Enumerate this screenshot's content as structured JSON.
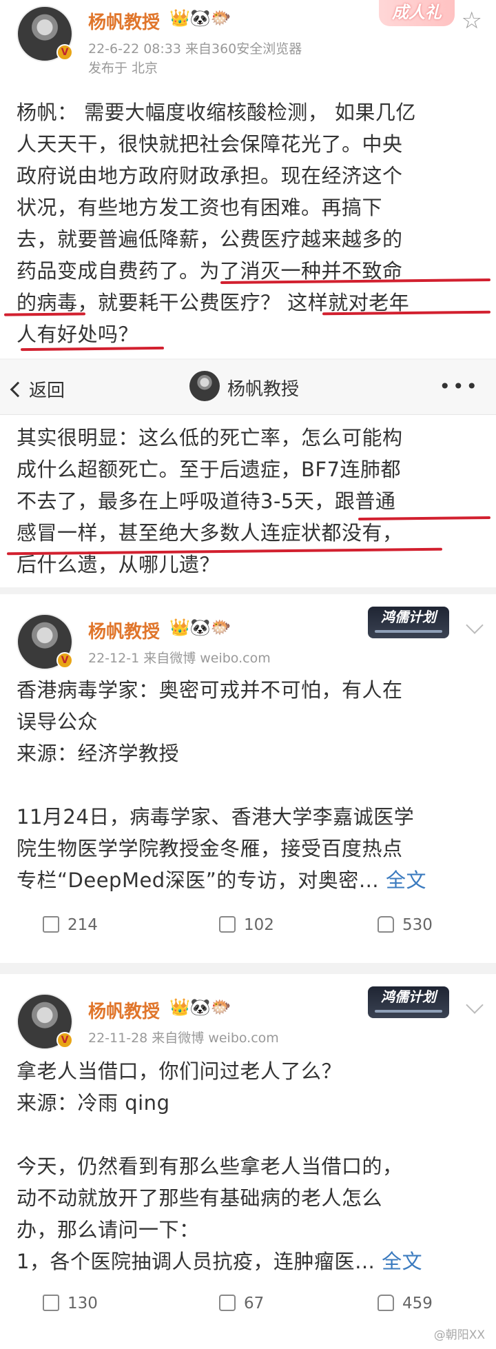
{
  "post1": {
    "user": "杨帆教授",
    "badges": "👑🐼🐡",
    "meta_line1": "22-6-22 08:33  来自360安全浏览器",
    "meta_line2": "发布于 北京",
    "ribbon": "成人礼",
    "lines": [
      "杨帆： 需要大幅度收缩核酸检测， 如果几亿",
      "人天天干，很快就把社会保障花光了。中央",
      "政府说由地方政府财政承担。现在经济这个",
      "状况，有些地方发工资也有困难。再搞下",
      "去，就要普遍低降薪，公费医疗越来越多的",
      "药品变成自费药了。为了消灭一种并不致命",
      "的病毒，就要耗干公费医疗？ 这样就对老年",
      "人有好处吗？"
    ]
  },
  "nav": {
    "back_label": "返回",
    "title": "杨帆教授",
    "more": "•••"
  },
  "post2": {
    "lines": [
      "其实很明显：这么低的死亡率，怎么可能构",
      "成什么超额死亡。至于后遗症，BF7连肺都",
      "不去了，最多在上呼吸道待3-5天，跟普通",
      "感冒一样，甚至绝大多数人连症状都没有，",
      "后什么遗，从哪儿遗？"
    ]
  },
  "post3": {
    "user": "杨帆教授",
    "badges": "👑🐼🐡",
    "meta": "22-12-1  来自微博 weibo.com",
    "tag": "鸿儒计划",
    "lines": [
      "香港病毒学家：奥密可戎并不可怕，有人在",
      "误导公众",
      "来源：经济学教授",
      "",
      "11月24日，病毒学家、香港大学李嘉诚医学",
      "院生物医学学院教授金冬雁，接受百度热点",
      "专栏“DeepMed深医”的专访，对奥密…"
    ],
    "fulltext": "全文",
    "shares": "214",
    "comments": "102",
    "likes": "530"
  },
  "post4": {
    "user": "杨帆教授",
    "badges": "👑🐼🐡",
    "meta": "22-11-28  来自微博 weibo.com",
    "tag": "鸿儒计划",
    "lines": [
      "拿老人当借口，你们问过老人了么？",
      "来源：冷雨 qing",
      "",
      "今天，仍然看到有那么些拿老人当借口的，",
      "动不动就放开了那些有基础病的老人怎么",
      "办，那么请问一下：",
      "1，各个医院抽调人员抗疫，连肿瘤医…"
    ],
    "fulltext": "全文",
    "shares": "130",
    "comments": "67",
    "likes": "459"
  },
  "watermark": "@朝阳XX",
  "colors": {
    "username": "#e0762c",
    "underline": "#d2202f",
    "link": "#3b7bbf"
  },
  "icons": [
    "star-icon",
    "back-arrow-icon",
    "more-icon",
    "share-icon",
    "comment-icon",
    "like-icon",
    "chevron-down-icon",
    "verified-badge-icon"
  ]
}
